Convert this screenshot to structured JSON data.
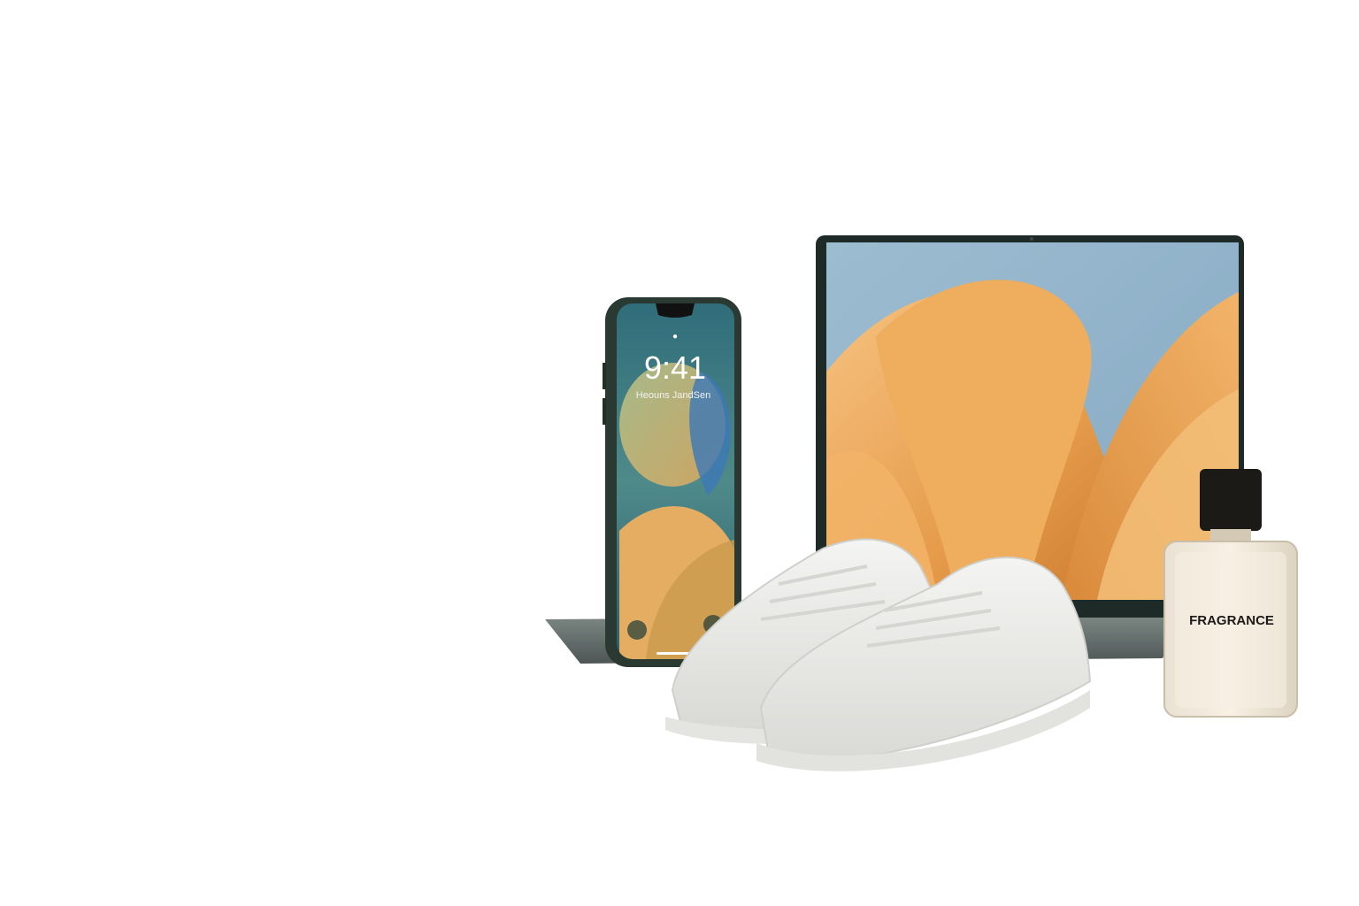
{
  "phone": {
    "time": "9:41",
    "date": "Heouns JandSen"
  },
  "perfume": {
    "label": "FRAGRANCE"
  },
  "colors": {
    "background": "#ffffff",
    "laptop_wallpaper_blue": "#8fb2c8",
    "laptop_wallpaper_orange": "#e9a24e",
    "phone_body": "#2c3b34",
    "sneaker": "#eeeeec",
    "perfume_cap": "#1c1a17",
    "perfume_liquid": "#f3eadb"
  },
  "icons": [
    "flashlight-icon",
    "camera-icon",
    "lock-icon"
  ]
}
